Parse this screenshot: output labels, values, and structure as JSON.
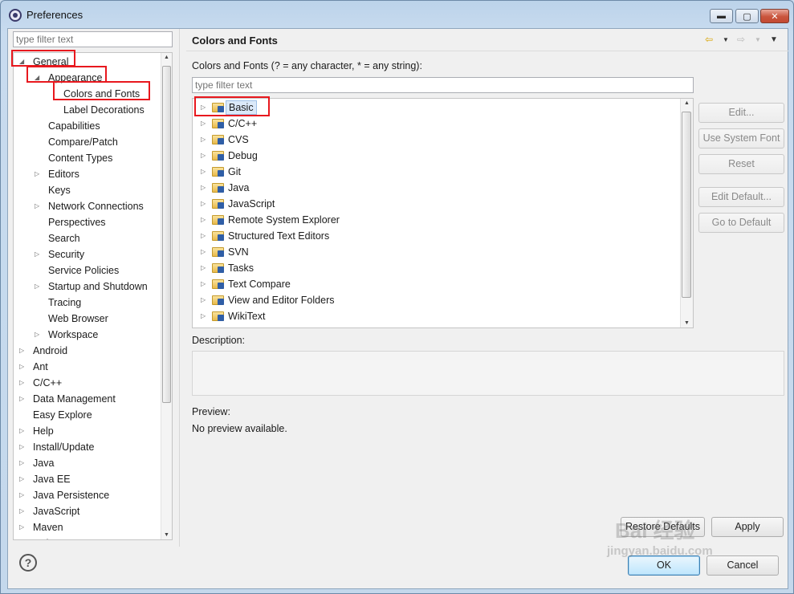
{
  "window": {
    "title": "Preferences",
    "min_label": "▬",
    "max_label": "▢",
    "close_label": "✕"
  },
  "left": {
    "filter_placeholder": "type filter text",
    "tree": [
      {
        "label": "General",
        "depth": 0,
        "expander": "◢"
      },
      {
        "label": "Appearance",
        "depth": 1,
        "expander": "◢"
      },
      {
        "label": "Colors and Fonts",
        "depth": 2,
        "expander": ""
      },
      {
        "label": "Label Decorations",
        "depth": 2,
        "expander": ""
      },
      {
        "label": "Capabilities",
        "depth": 1,
        "expander": ""
      },
      {
        "label": "Compare/Patch",
        "depth": 1,
        "expander": ""
      },
      {
        "label": "Content Types",
        "depth": 1,
        "expander": ""
      },
      {
        "label": "Editors",
        "depth": 1,
        "expander": "▷"
      },
      {
        "label": "Keys",
        "depth": 1,
        "expander": ""
      },
      {
        "label": "Network Connections",
        "depth": 1,
        "expander": "▷"
      },
      {
        "label": "Perspectives",
        "depth": 1,
        "expander": ""
      },
      {
        "label": "Search",
        "depth": 1,
        "expander": ""
      },
      {
        "label": "Security",
        "depth": 1,
        "expander": "▷"
      },
      {
        "label": "Service Policies",
        "depth": 1,
        "expander": ""
      },
      {
        "label": "Startup and Shutdown",
        "depth": 1,
        "expander": "▷"
      },
      {
        "label": "Tracing",
        "depth": 1,
        "expander": ""
      },
      {
        "label": "Web Browser",
        "depth": 1,
        "expander": ""
      },
      {
        "label": "Workspace",
        "depth": 1,
        "expander": "▷"
      },
      {
        "label": "Android",
        "depth": 0,
        "expander": "▷"
      },
      {
        "label": "Ant",
        "depth": 0,
        "expander": "▷"
      },
      {
        "label": "C/C++",
        "depth": 0,
        "expander": "▷"
      },
      {
        "label": "Data Management",
        "depth": 0,
        "expander": "▷"
      },
      {
        "label": "Easy Explore",
        "depth": 0,
        "expander": ""
      },
      {
        "label": "Help",
        "depth": 0,
        "expander": "▷"
      },
      {
        "label": "Install/Update",
        "depth": 0,
        "expander": "▷"
      },
      {
        "label": "Java",
        "depth": 0,
        "expander": "▷"
      },
      {
        "label": "Java EE",
        "depth": 0,
        "expander": "▷"
      },
      {
        "label": "Java Persistence",
        "depth": 0,
        "expander": "▷"
      },
      {
        "label": "JavaScript",
        "depth": 0,
        "expander": "▷"
      },
      {
        "label": "Maven",
        "depth": 0,
        "expander": "▷"
      },
      {
        "label": "Mylyn",
        "depth": 0,
        "expander": "▷"
      }
    ]
  },
  "right": {
    "title": "Colors and Fonts",
    "filter_label": "Colors and Fonts (? = any character, * = any string):",
    "filter_placeholder": "type filter text",
    "categories": [
      "Basic",
      "C/C++",
      "CVS",
      "Debug",
      "Git",
      "Java",
      "JavaScript",
      "Remote System Explorer",
      "Structured Text Editors",
      "SVN",
      "Tasks",
      "Text Compare",
      "View and Editor Folders",
      "WikiText"
    ],
    "buttons": {
      "edit": "Edit...",
      "use_system_font": "Use System Font",
      "reset": "Reset",
      "edit_default": "Edit Default...",
      "go_to_default": "Go to Default"
    },
    "description_label": "Description:",
    "preview_label": "Preview:",
    "preview_text": "No preview available.",
    "restore_defaults": "Restore Defaults",
    "apply": "Apply"
  },
  "footer": {
    "help": "?",
    "ok": "OK",
    "cancel": "Cancel"
  },
  "watermark": "Bai 经验\njingyan.baidu.com",
  "colors": {
    "highlight_red": "#e8181e",
    "selection": "#dbe9f9"
  }
}
